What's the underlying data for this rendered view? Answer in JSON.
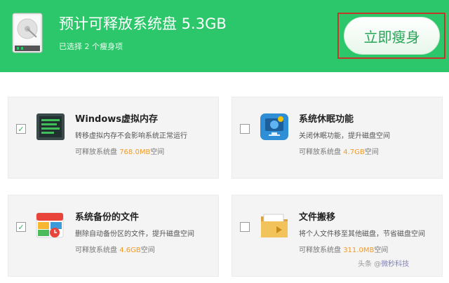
{
  "header": {
    "title": "预计可释放系统盘 5.3GB",
    "subtitle": "已选择 2 个瘦身项",
    "slim_button": "立即瘦身"
  },
  "colors": {
    "brand_green": "#2cc76a",
    "size_orange": "#f39a1f",
    "highlight_red": "#c0392b"
  },
  "items": [
    {
      "title": "Windows虚拟内存",
      "desc": "转移虚拟内存不会影响系统正常运行",
      "size_prefix": "可释放系统盘 ",
      "size": "768.0MB",
      "size_suffix": "空间",
      "checked": true,
      "icon": "memory-chip-icon"
    },
    {
      "title": "系统休眠功能",
      "desc": "关闭休眠功能，提升磁盘空间",
      "size_prefix": "可释放系统盘 ",
      "size": "4.7GB",
      "size_suffix": "空间",
      "checked": false,
      "icon": "sleep-monitor-icon"
    },
    {
      "title": "系统备份的文件",
      "desc": "删除自动备份区的文件，提升磁盘空间",
      "size_prefix": "可释放系统盘 ",
      "size": "4.6GB",
      "size_suffix": "空间",
      "checked": true,
      "icon": "backup-calendar-icon"
    },
    {
      "title": "文件搬移",
      "desc": "将个人文件移至其他磁盘，节省磁盘空间",
      "size_prefix": "可释放系统盘 ",
      "size": "311.0MB",
      "size_suffix": "空间",
      "checked": false,
      "icon": "folder-move-icon"
    }
  ],
  "watermark": {
    "prefix": "头条 @",
    "name": "微秒科技"
  }
}
